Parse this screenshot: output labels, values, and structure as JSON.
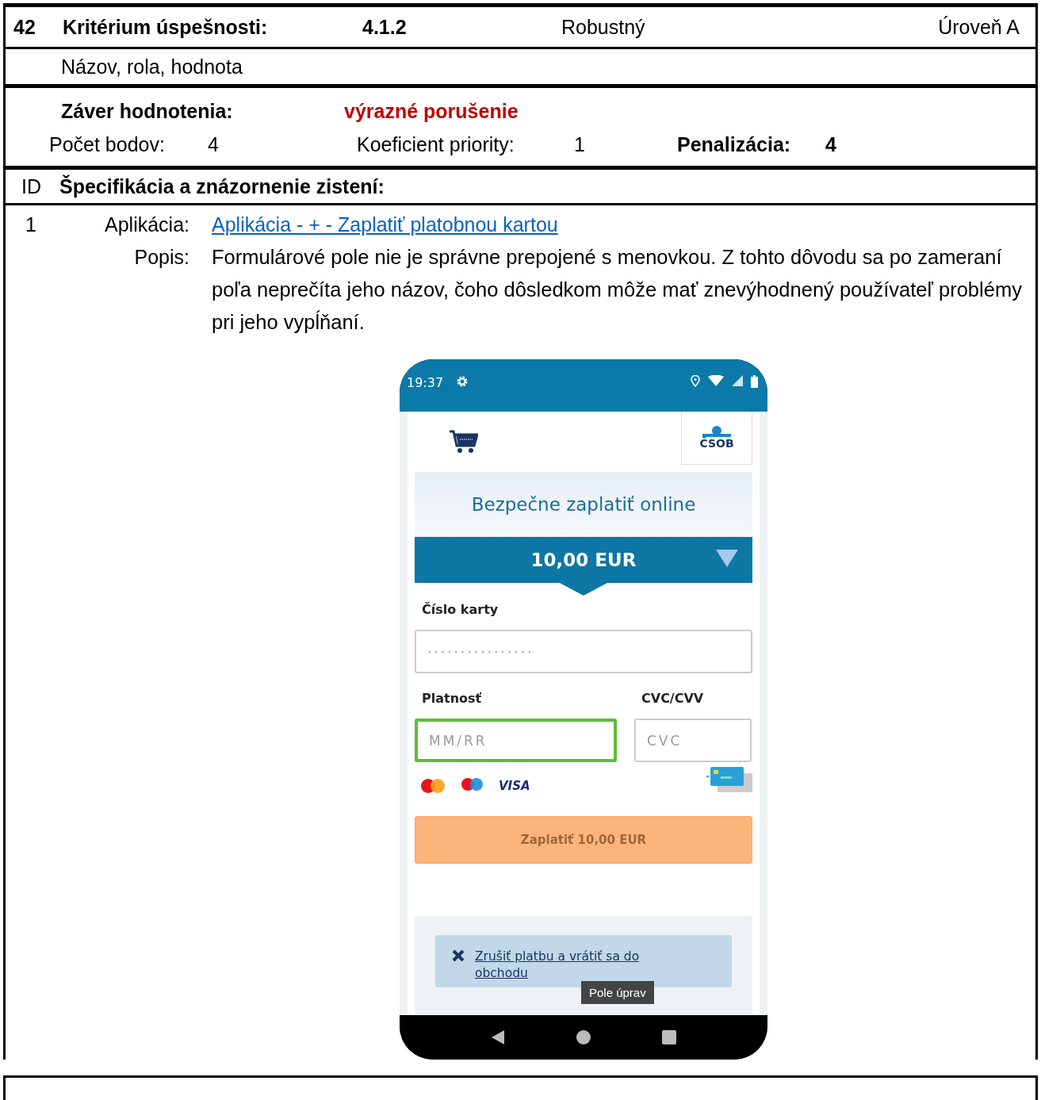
{
  "criterion": {
    "number": "42",
    "label": "Kritérium úspešnosti:",
    "code": "4.1.2",
    "principle": "Robustný",
    "level": "Úroveň A",
    "name": "Názov, rola, hodnota"
  },
  "evaluation": {
    "label": "Záver hodnotenia:",
    "verdict": "výrazné porušenie",
    "points_label": "Počet bodov:",
    "points": "4",
    "priority_label": "Koeficient priority:",
    "priority": "1",
    "penalty_label": "Penalizácia:",
    "penalty": "4"
  },
  "findings_header": {
    "id": "ID",
    "title": "Špecifikácia a znázornenie zistení:"
  },
  "findings": [
    {
      "id": "1",
      "app_label": "Aplikácia:",
      "app_link": "Aplikácia - + - Zaplatiť platobnou kartou",
      "desc_label": "Popis:",
      "description": "Formulárové pole nie je správne prepojené s menovkou. Z tohto dôvodu sa po zameraní poľa neprečíta jeho názov, čoho dôsledkom môže mať znevýhodnený používateľ problémy pri jeho vypĺňaní.",
      "phone": {
        "time": "19:37",
        "logo": "ČSOB",
        "title": "Bezpečne zaplatiť online",
        "amount": "10,00 EUR",
        "fields": [
          {
            "label": "Číslo karty",
            "placeholder": "················",
            "focused": false
          },
          {
            "label": "Platnosť",
            "placeholder": "MM/RR",
            "focused": true
          },
          {
            "label": "CVC/CVV",
            "placeholder": "CVC",
            "focused": false
          }
        ],
        "brand": "VISA",
        "pay_button": "Zaplatiť 10,00 EUR",
        "cancel_link": "Zrušiť platbu a vrátiť sa do obchodu",
        "tooltip": "Pole úprav"
      }
    }
  ]
}
